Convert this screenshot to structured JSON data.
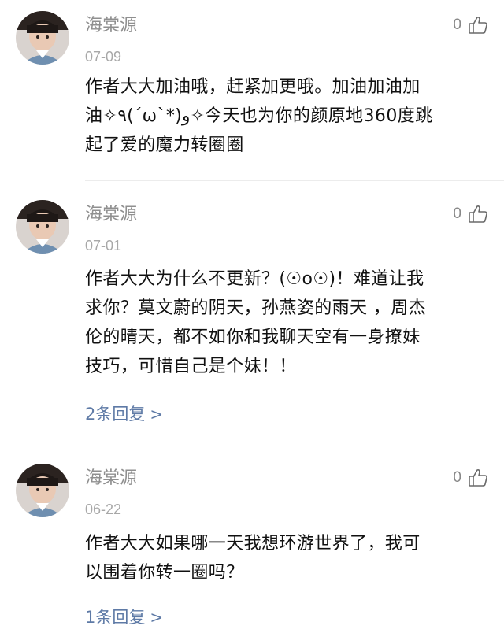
{
  "comments": [
    {
      "username": "海棠源",
      "date": "07-09",
      "likes": "0",
      "text_lines": [
        "作者大大加油哦，赶紧加更哦。加油加油加",
        "油✧٩(ˊωˋ*)و✧今天也为你的颜原地360度跳",
        "起了爱的魔力转圈圈"
      ]
    },
    {
      "username": "海棠源",
      "date": "07-01",
      "likes": "0",
      "text_lines": [
        "作者大大为什么不更新？(☉o☉)！难道让我",
        "求你？莫文蔚的阴天，孙燕姿的雨天 ，周杰",
        "伦的晴天，都不如你和我聊天空有一身撩妹",
        "技巧，可惜自己是个妹！！"
      ],
      "replies": "2条回复",
      "reply_arrow": ">"
    },
    {
      "username": "海棠源",
      "date": "06-22",
      "likes": "0",
      "text_lines": [
        "作者大大如果哪一天我想环游世界了，我可",
        "以围着你转一圈吗？"
      ],
      "replies": "1条回复",
      "reply_arrow": ">"
    }
  ],
  "colors": {
    "username": "#8f8f8f",
    "reply_link": "#5e7aa6",
    "divider": "#ececec"
  },
  "icons": {
    "like": "thumbs-up-icon",
    "avatar": "user-avatar"
  }
}
